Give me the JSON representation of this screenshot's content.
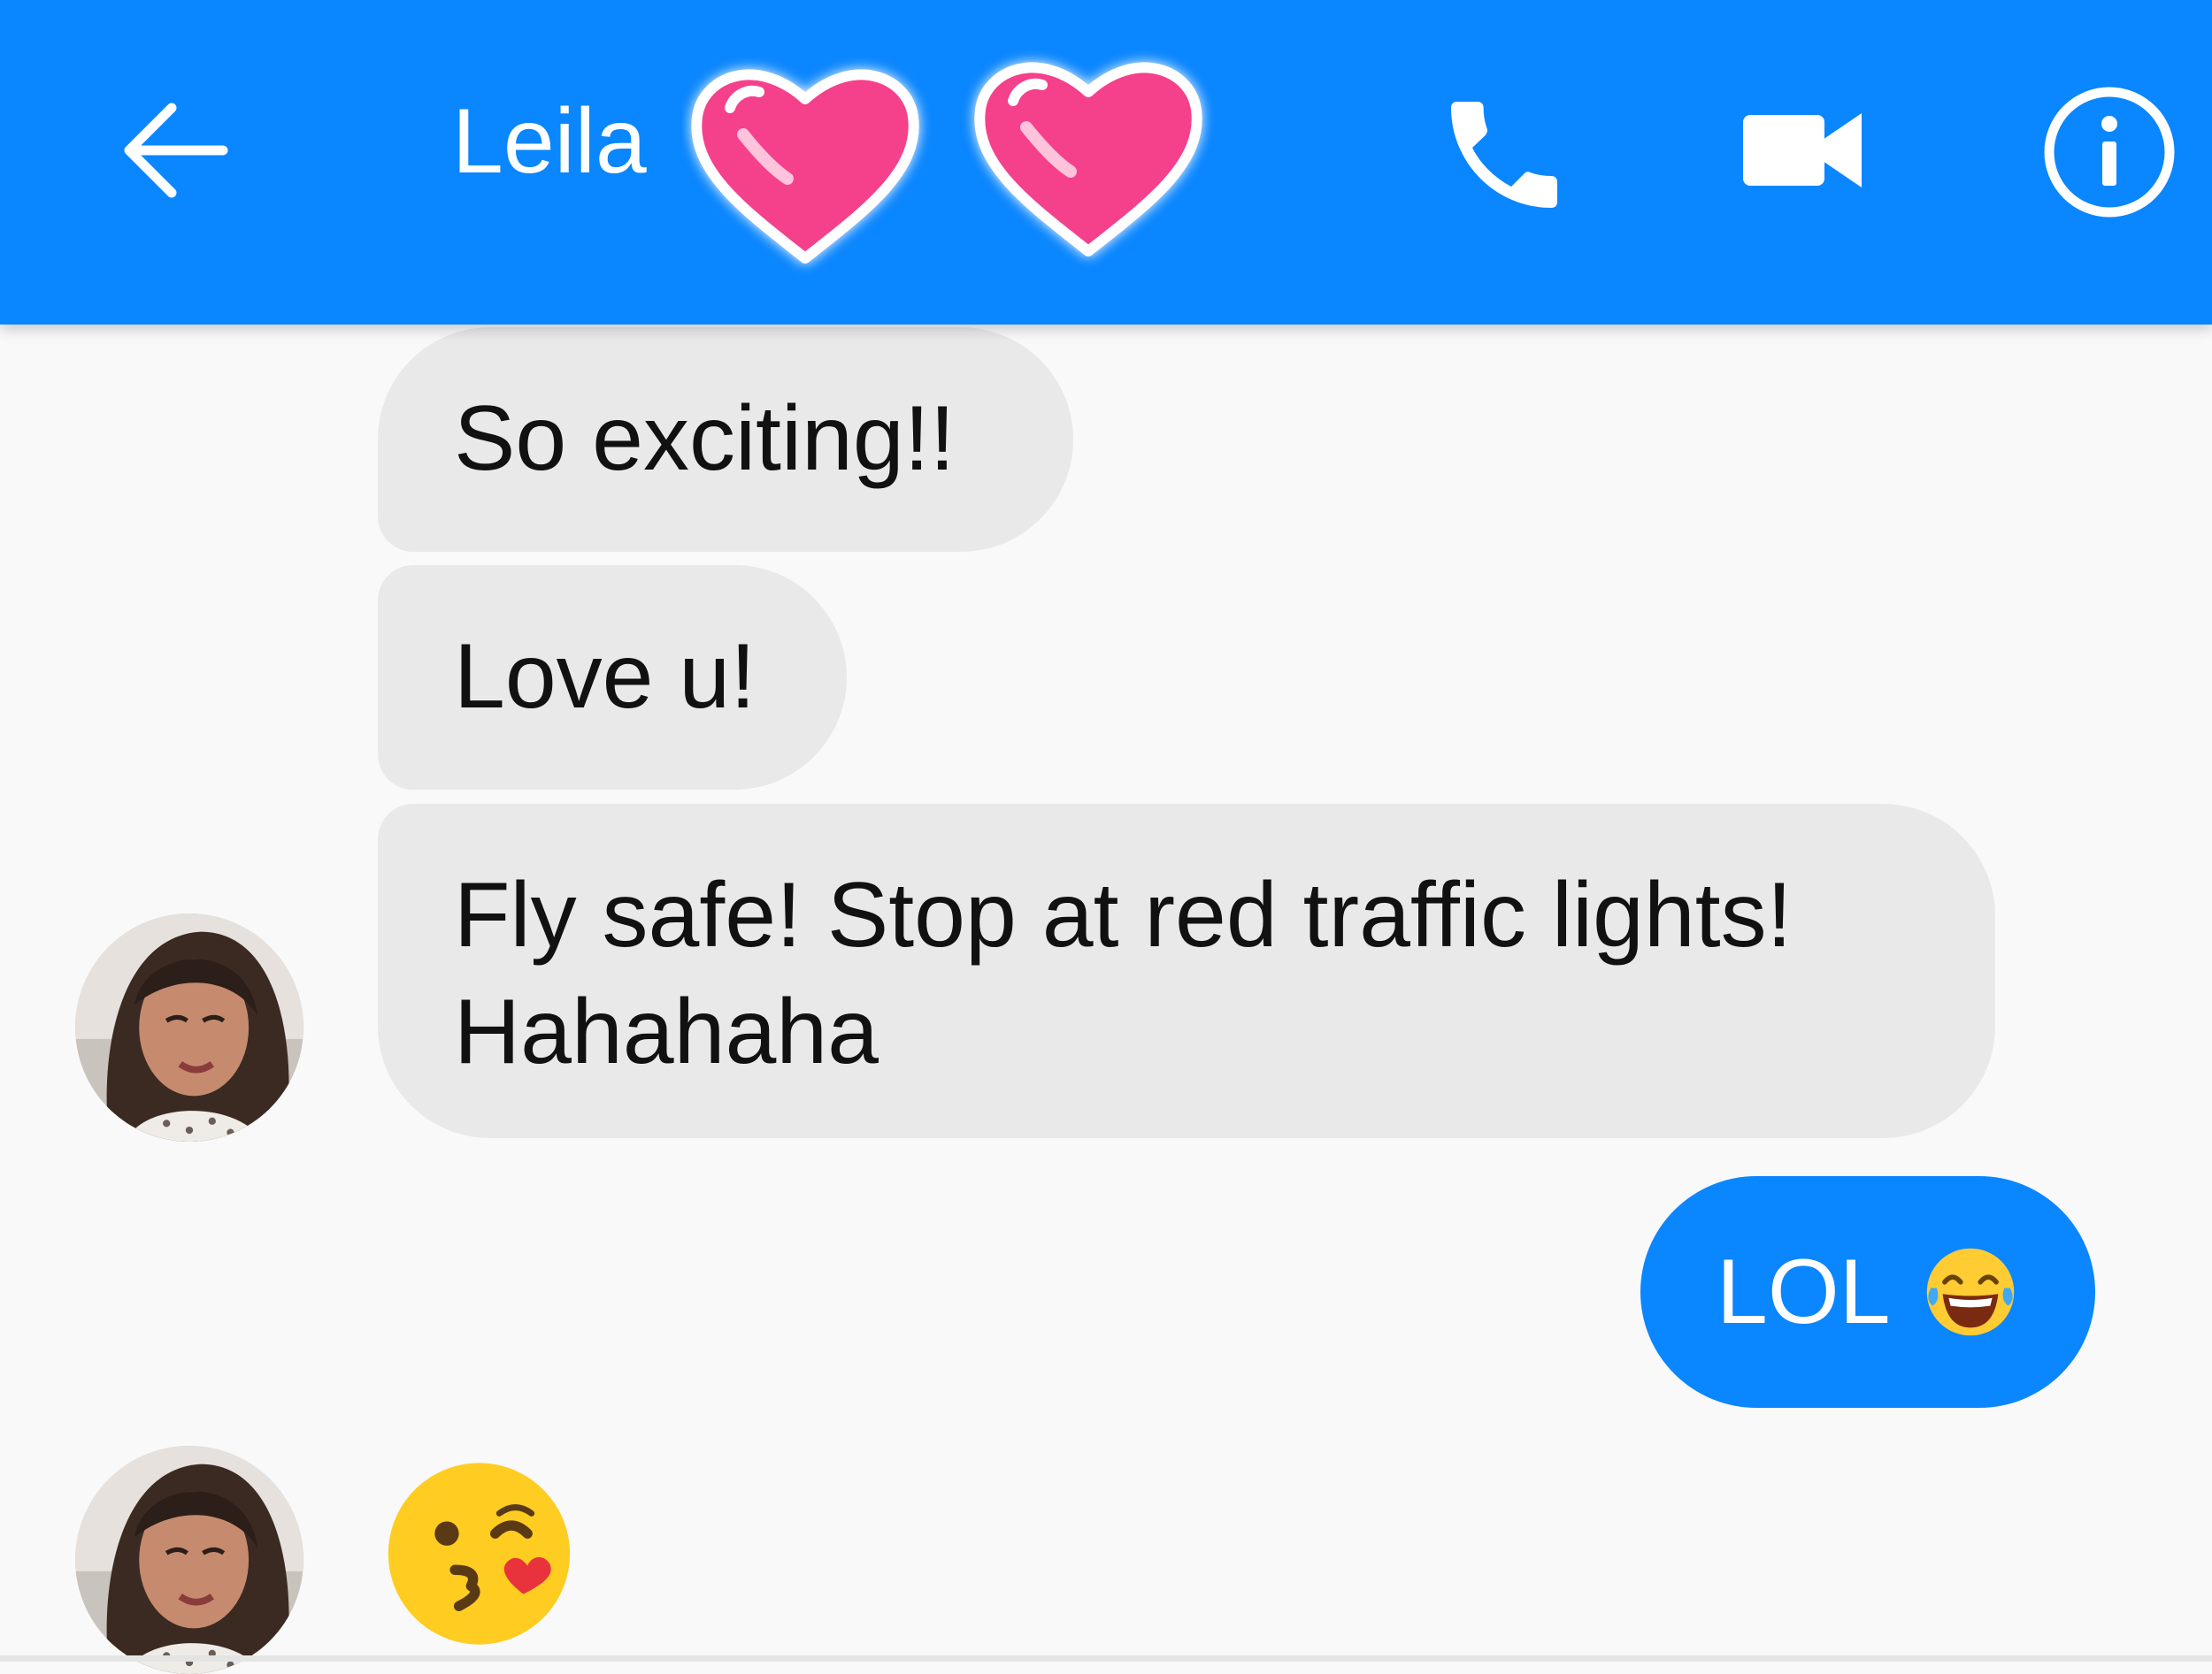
{
  "header": {
    "contact_name": "Leila",
    "background_color": "#0a86ff",
    "icons": {
      "back": "arrow-left-icon",
      "call": "phone-icon",
      "video": "video-camera-icon",
      "info": "info-icon",
      "overlay": "heart-sticker-icon"
    }
  },
  "conversation": {
    "incoming_bubble_color": "#e9e9e9",
    "outgoing_bubble_color": "#0a86ff",
    "messages": [
      {
        "direction": "incoming",
        "text": "So exciting!!"
      },
      {
        "direction": "incoming",
        "text": "Love u!"
      },
      {
        "direction": "incoming",
        "text": "Fly safe! Stop at red traffic lights! Hahahaha"
      },
      {
        "direction": "outgoing",
        "text": "LOL",
        "emoji": "tears-of-joy-emoji"
      },
      {
        "direction": "incoming",
        "emoji": "kissing-wink-heart-emoji"
      }
    ]
  }
}
